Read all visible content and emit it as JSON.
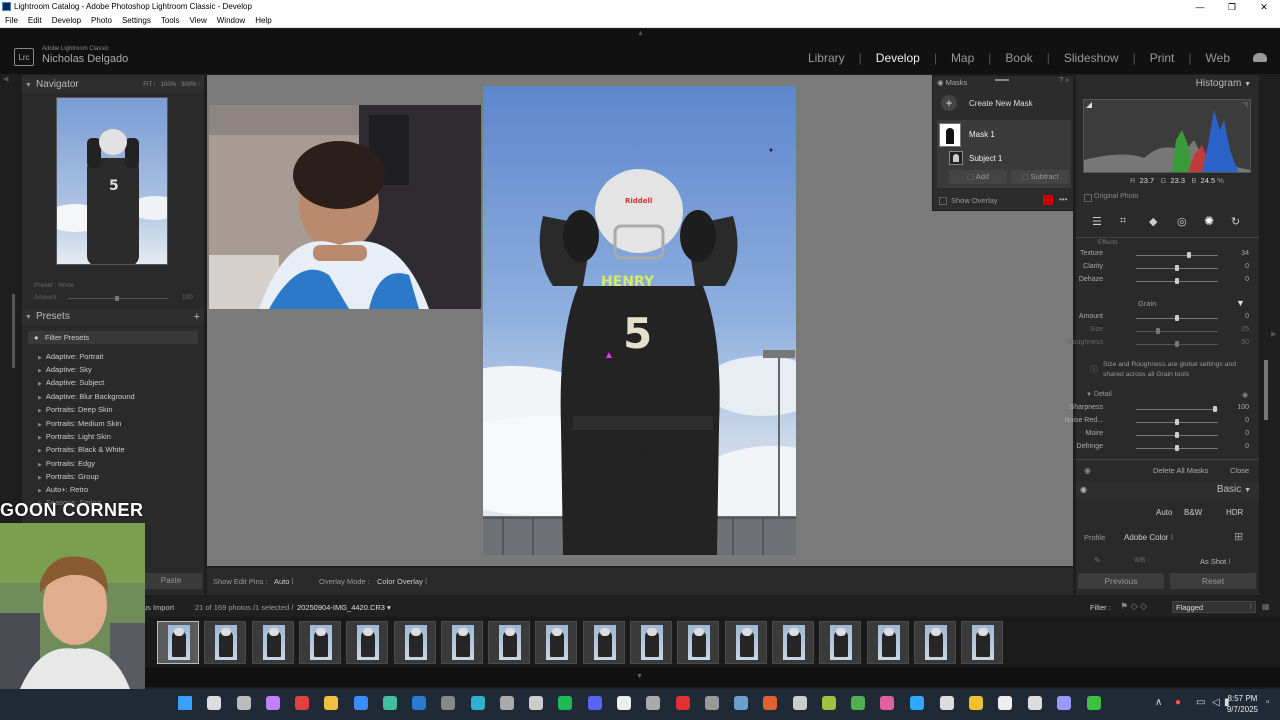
{
  "window": {
    "title": "Lightroom Catalog - Adobe Photoshop Lightroom Classic - Develop",
    "controls": [
      "—",
      "❐",
      "✕"
    ]
  },
  "menu": [
    "File",
    "Edit",
    "Develop",
    "Photo",
    "Settings",
    "Tools",
    "View",
    "Window",
    "Help"
  ],
  "identity": {
    "logo": "Lrc",
    "app": "Adobe Lightroom Classic",
    "user": "Nicholas Delgado"
  },
  "modules": [
    "Library",
    "Develop",
    "Map",
    "Book",
    "Slideshow",
    "Print",
    "Web"
  ],
  "active_module": "Develop",
  "navigator": {
    "title": "Navigator",
    "zoom_options": [
      "FIT ⁝",
      "100%",
      "300% ⁝"
    ]
  },
  "preset_amount": {
    "preset_label": "Preset :",
    "preset_value": "None",
    "amount_label": "Amount",
    "amount_value": "100"
  },
  "presets": {
    "title": "Presets",
    "filter_label": "Filter Presets",
    "items": [
      "Adaptive: Portrait",
      "Adaptive: Sky",
      "Adaptive: Subject",
      "Adaptive: Blur Background",
      "Portraits: Deep Skin",
      "Portraits: Medium Skin",
      "Portraits: Light Skin",
      "Portraits: Black & White",
      "Portraits: Edgy",
      "Portraits: Group",
      "Auto+: Retro",
      "Seasons: Spring"
    ]
  },
  "masks": {
    "title": "Masks",
    "create_label": "Create New Mask",
    "mask_name": "Mask 1",
    "subject_name": "Subject 1",
    "add_label": "Add",
    "subtract_label": "Subtract",
    "overlay_label": "Show Overlay",
    "overlay_color": "#cc0000"
  },
  "histogram": {
    "title": "Histogram",
    "r_label": "R",
    "r_value": "23.7",
    "g_label": "G",
    "g_value": "23.3",
    "b_label": "B",
    "b_value": "24.5",
    "pct": "%",
    "original_label": "Original Photo"
  },
  "effects": {
    "section_partial": "Effects",
    "sliders": [
      {
        "label": "Texture",
        "value": "34",
        "pos": 0.67
      },
      {
        "label": "Clarity",
        "value": "0",
        "pos": 0.5
      },
      {
        "label": "Dehaze",
        "value": "0",
        "pos": 0.5
      }
    ]
  },
  "grain": {
    "title": "Grain",
    "sliders": [
      {
        "label": "Amount",
        "value": "0",
        "pos": 0.5,
        "dim": false
      },
      {
        "label": "Size",
        "value": "25",
        "pos": 0.25,
        "dim": true
      },
      {
        "label": "Roughness",
        "value": "50",
        "pos": 0.5,
        "dim": true
      }
    ],
    "note": "Size and Roughness are global settings and shared across all Grain tools"
  },
  "detail": {
    "title": "Detail",
    "sliders": [
      {
        "label": "Sharpness",
        "value": "100",
        "pos": 1.0
      },
      {
        "label": "Noise Red...",
        "value": "0",
        "pos": 0.5
      },
      {
        "label": "Moire",
        "value": "0",
        "pos": 0.5
      },
      {
        "label": "Defringe",
        "value": "0",
        "pos": 0.5
      }
    ]
  },
  "mask_footer": {
    "delete_label": "Delete All Masks",
    "close_label": "Close"
  },
  "basic": {
    "title": "Basic",
    "treatment": [
      "Auto",
      "B&W",
      "HDR"
    ],
    "profile_label": "Profile",
    "profile_value": "Adobe Color ⁝",
    "wb_label": "WB :",
    "wb_value": "As Shot ⁝"
  },
  "buttons": {
    "paste": "Paste",
    "previous": "Previous",
    "reset": "Reset"
  },
  "toolbar": {
    "pins_label": "Show Edit Pins :",
    "pins_value": "Auto ⁝",
    "overlay_mode_label": "Overlay Mode :",
    "overlay_mode_value": "Color Overlay ⁝"
  },
  "filmbar": {
    "source_partial": "us Import",
    "count": "21 of 169 photos /1 selected /",
    "filename": "20250904-IMG_4420.CR3 ▾",
    "filter_label": "Filter :",
    "filter_value": "Flagged"
  },
  "film_thumbs_count": 18,
  "selected_thumb_index": 0,
  "overlay_text": "GOON CORNER",
  "taskbar": {
    "time": "8:57 PM",
    "date": "9/7/2025",
    "tray_up": "∧",
    "mic": "🎤"
  }
}
